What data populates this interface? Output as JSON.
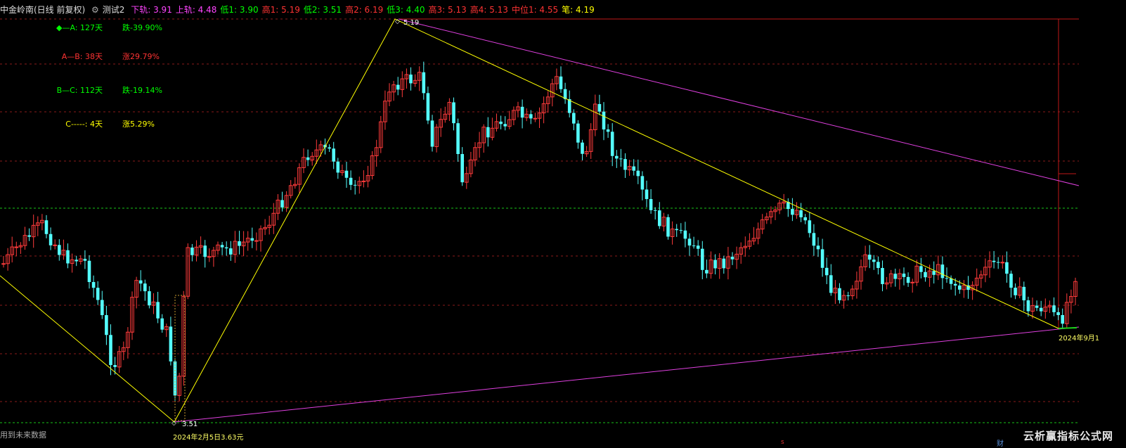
{
  "header": {
    "title": "中金岭南(日线 前复权)",
    "indicator_name": "测试2",
    "items": [
      {
        "label": "下轨: 3.91",
        "color": "#ff44ff"
      },
      {
        "label": "上轨: 4.48",
        "color": "#ff44ff"
      },
      {
        "label": "低1: 3.90",
        "color": "#00ff00"
      },
      {
        "label": "高1: 5.19",
        "color": "#ff3333"
      },
      {
        "label": "低2: 3.51",
        "color": "#00ff00"
      },
      {
        "label": "高2: 6.19",
        "color": "#ff3333"
      },
      {
        "label": "低3: 4.40",
        "color": "#00ff00"
      },
      {
        "label": "高3: 5.13",
        "color": "#ff3333"
      },
      {
        "label": "高4: 5.13",
        "color": "#ff3333"
      },
      {
        "label": "中位1: 4.55",
        "color": "#ff3333"
      },
      {
        "label": "笔: 4.19",
        "color": "#ffff00"
      }
    ]
  },
  "stats": [
    {
      "label": "◆—A: 127天",
      "pct": "跌-39.90%",
      "color": "#00ff00"
    },
    {
      "label": "A—B: 38天",
      "pct": "涨29.79%",
      "color": "#ff3333"
    },
    {
      "label": "B—C: 112天",
      "pct": "跌-19.14%",
      "color": "#00ff00"
    },
    {
      "label": "C-----: 4天",
      "pct": "涨5.29%",
      "color": "#ffff00"
    }
  ],
  "annotations": {
    "high_label": "5.19",
    "low_label": "3.51",
    "low_date": "2024年2月5日3.63元",
    "right_date": "2024年9月1"
  },
  "footer": {
    "left_text": "用到未来数据",
    "watermark": "云析赢指标公式网",
    "cai": "财",
    "small_mark": "s"
  },
  "colors": {
    "up": "#ff3b3b",
    "down": "#54ffff",
    "pen": "#ffff00",
    "channel": "#e040e0",
    "grid": "#8a1a1a"
  },
  "chart_data": {
    "type": "candlestick",
    "price_range": [
      3.51,
      5.19
    ],
    "high_point": 5.19,
    "low_point": 3.51,
    "upper_band": 4.48,
    "lower_band": 3.91,
    "pen_points": [
      {
        "label": "start",
        "price": 4.48
      },
      {
        "label": "A",
        "price": 3.51
      },
      {
        "label": "B",
        "price": 5.19
      },
      {
        "label": "C",
        "price": 3.9
      },
      {
        "label": "now",
        "price": 4.19
      }
    ]
  }
}
